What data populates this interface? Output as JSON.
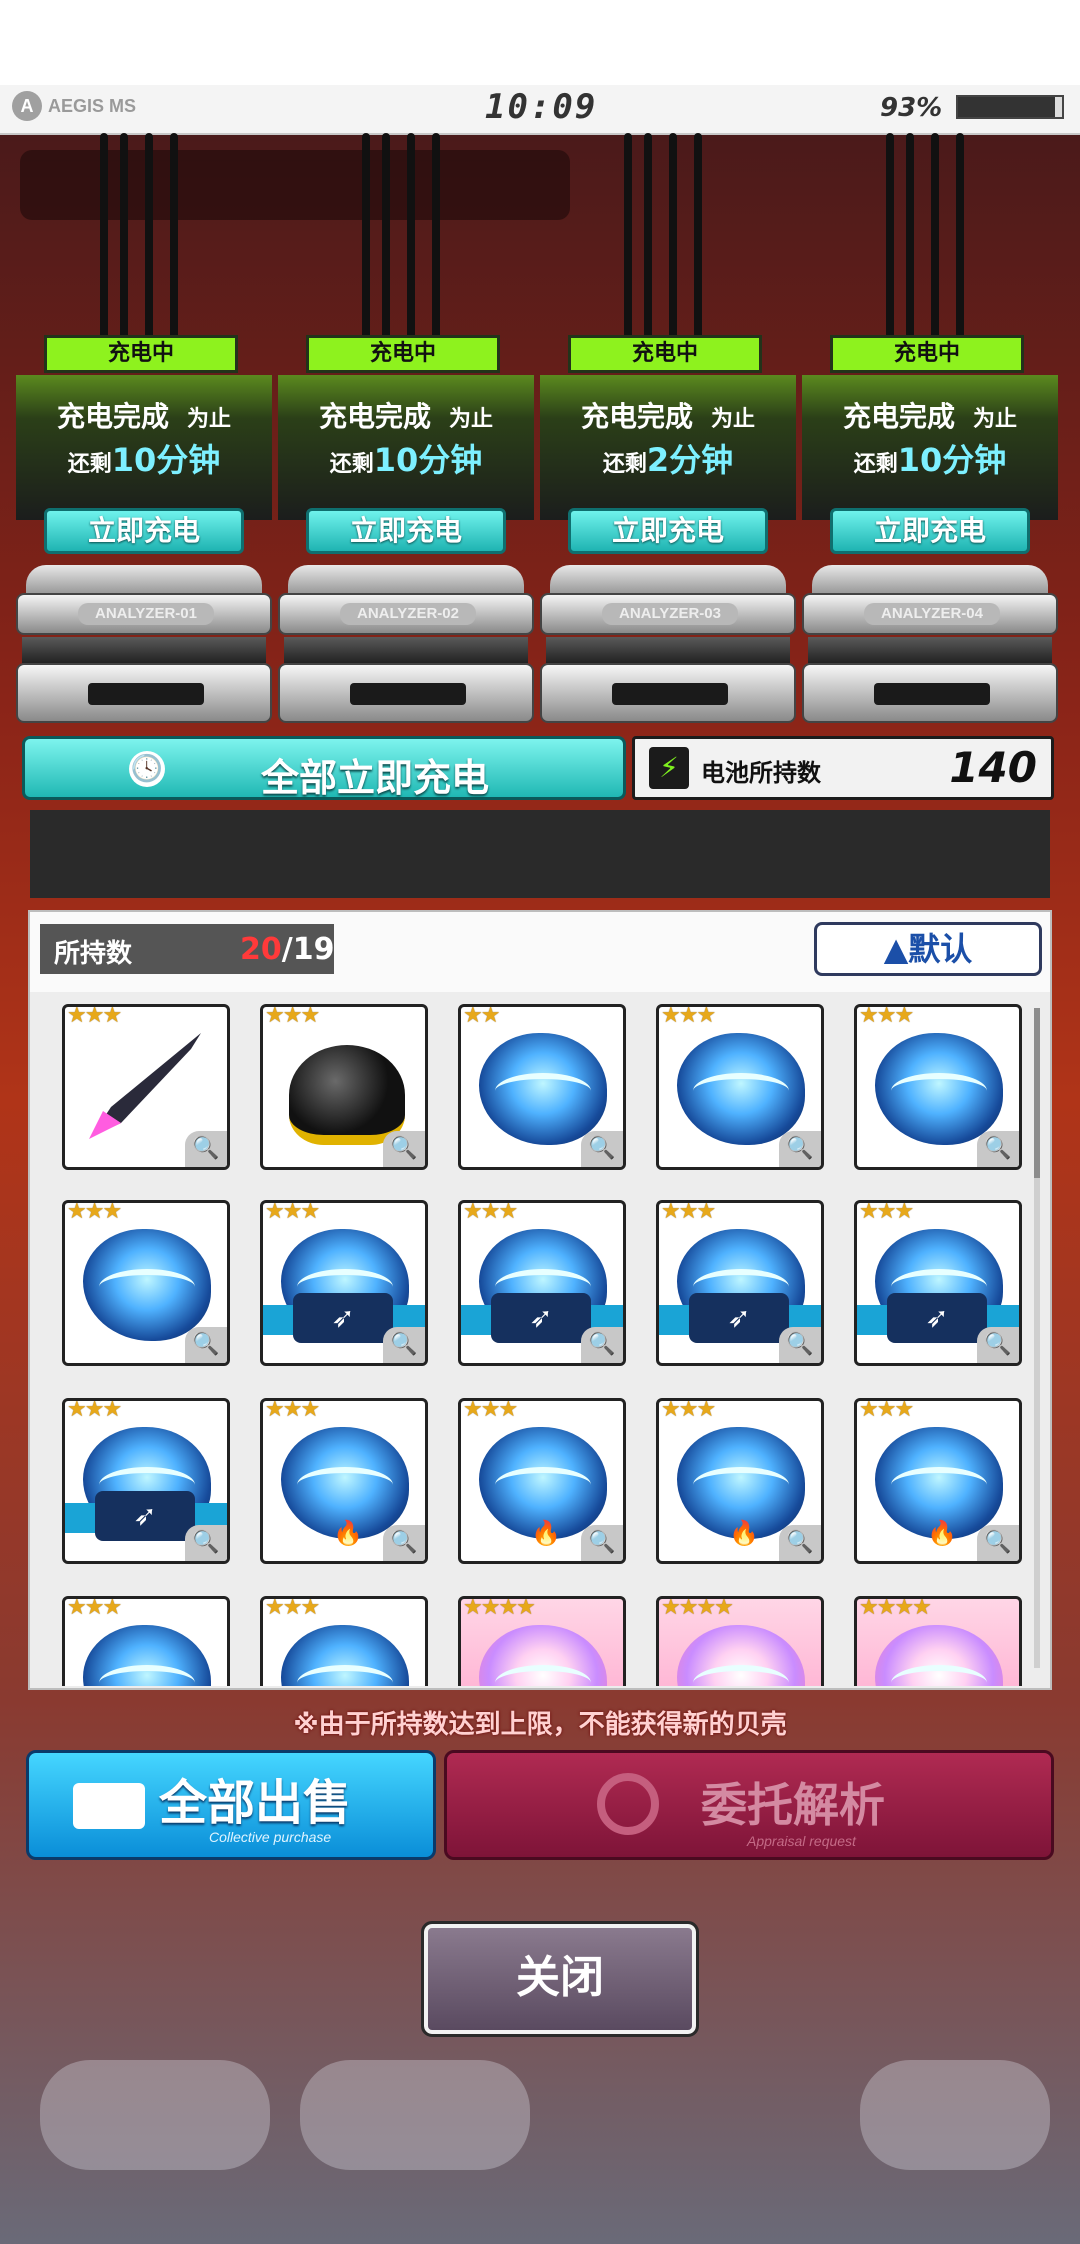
{
  "status_bar": {
    "brand": "AEGIS MS",
    "brand_glyph": "A",
    "time": "10:09",
    "battery_text": "93%",
    "battery_level": 0.93
  },
  "chargers": [
    {
      "status": "充电中",
      "line1": "充电完成",
      "line1_suffix": "为止",
      "remain_prefix": "还剩",
      "remain_value": "10分钟",
      "button": "立即充电",
      "plate": "ANALYZER-01"
    },
    {
      "status": "充电中",
      "line1": "充电完成",
      "line1_suffix": "为止",
      "remain_prefix": "还剩",
      "remain_value": "10分钟",
      "button": "立即充电",
      "plate": "ANALYZER-02"
    },
    {
      "status": "充电中",
      "line1": "充电完成",
      "line1_suffix": "为止",
      "remain_prefix": "还剩",
      "remain_value": "2分钟",
      "button": "立即充电",
      "plate": "ANALYZER-03"
    },
    {
      "status": "充电中",
      "line1": "充电完成",
      "line1_suffix": "为止",
      "remain_prefix": "还剩",
      "remain_value": "10分钟",
      "button": "立即充电",
      "plate": "ANALYZER-04"
    }
  ],
  "actions": {
    "charge_all": "全部立即充电",
    "battery_label": "电池所持数",
    "battery_count": "140"
  },
  "inventory": {
    "count_label": "所持数",
    "count_current": "20",
    "count_max": "/19",
    "sort_label": "▲默认",
    "items": [
      {
        "stars": "★★★",
        "kind": "spear"
      },
      {
        "stars": "★★★",
        "kind": "helmet"
      },
      {
        "stars": "★★",
        "kind": "shell"
      },
      {
        "stars": "★★★",
        "kind": "shell"
      },
      {
        "stars": "★★★",
        "kind": "shell"
      },
      {
        "stars": "★★★",
        "kind": "shell"
      },
      {
        "stars": "★★★",
        "kind": "shell-tag"
      },
      {
        "stars": "★★★",
        "kind": "shell-tag"
      },
      {
        "stars": "★★★",
        "kind": "shell-tag"
      },
      {
        "stars": "★★★",
        "kind": "shell-tag"
      },
      {
        "stars": "★★★",
        "kind": "shell-tag"
      },
      {
        "stars": "★★★",
        "kind": "shell-flame"
      },
      {
        "stars": "★★★",
        "kind": "shell-flame"
      },
      {
        "stars": "★★★",
        "kind": "shell-flame"
      },
      {
        "stars": "★★★",
        "kind": "shell-flame"
      },
      {
        "stars": "★★★",
        "kind": "shell"
      },
      {
        "stars": "★★★",
        "kind": "shell"
      },
      {
        "stars": "★★★★",
        "kind": "shell-pink"
      },
      {
        "stars": "★★★★",
        "kind": "shell-pink"
      },
      {
        "stars": "★★★★",
        "kind": "shell-pink"
      }
    ]
  },
  "warning": "※由于所持数达到上限，不能获得新的贝壳",
  "footer": {
    "sell_label": "全部出售",
    "sell_sub": "Collective purchase",
    "appraise_label": "委托解析",
    "appraise_sub": "Appraisal request",
    "close_label": "关闭"
  },
  "colors": {
    "status_green": "#8ef21e",
    "teal_button": "#20b8b4",
    "blue_button": "#0a8ed8",
    "appraise_disabled": "#7e1438",
    "count_over_red": "#ff3a3a"
  },
  "icons": {
    "clock": "🕓",
    "battery": "⚡",
    "zoom": "🔍",
    "flame": "🔥"
  }
}
